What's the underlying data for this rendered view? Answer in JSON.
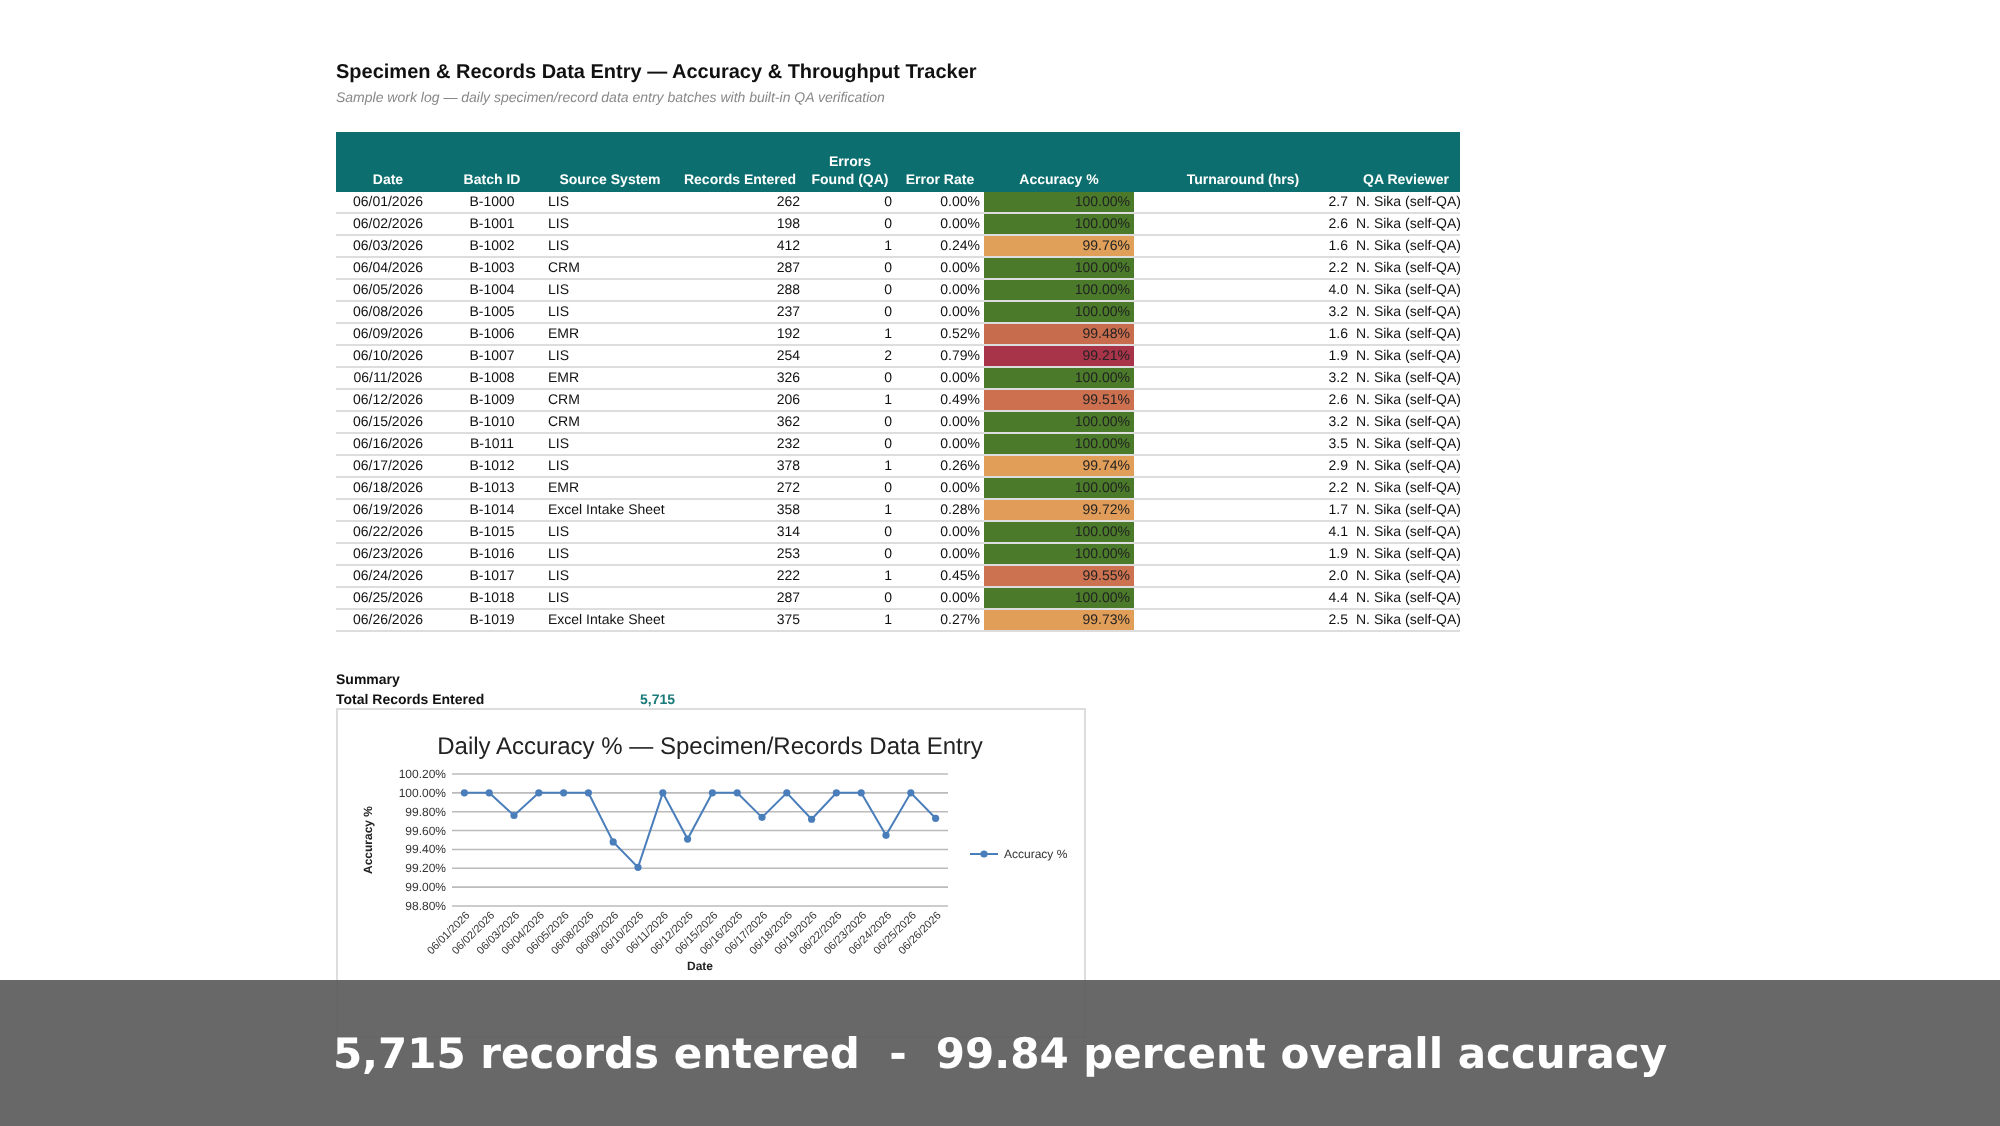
{
  "title": "Specimen & Records Data Entry — Accuracy & Throughput Tracker",
  "subtitle": "Sample work log — daily specimen/record data entry batches with built-in QA verification",
  "table": {
    "columns": [
      "Date",
      "Batch ID",
      "Source System",
      "Records Entered",
      "Errors Found (QA)",
      "Error Rate",
      "Accuracy %",
      "Turnaround (hrs)",
      "QA Reviewer"
    ],
    "rows": [
      {
        "date": "06/01/2026",
        "batch": "B-1000",
        "source": "LIS",
        "records": "262",
        "errors": "0",
        "rate": "0.00%",
        "accuracy": "100.00%",
        "color": "#4a7a2a",
        "hours": "2.7",
        "reviewer": "N. Sika (self-QA)"
      },
      {
        "date": "06/02/2026",
        "batch": "B-1001",
        "source": "LIS",
        "records": "198",
        "errors": "0",
        "rate": "0.00%",
        "accuracy": "100.00%",
        "color": "#4a7a2a",
        "hours": "2.6",
        "reviewer": "N. Sika (self-QA)"
      },
      {
        "date": "06/03/2026",
        "batch": "B-1002",
        "source": "LIS",
        "records": "412",
        "errors": "1",
        "rate": "0.24%",
        "accuracy": "99.76%",
        "color": "#e0a05a",
        "hours": "1.6",
        "reviewer": "N. Sika (self-QA)"
      },
      {
        "date": "06/04/2026",
        "batch": "B-1003",
        "source": "CRM",
        "records": "287",
        "errors": "0",
        "rate": "0.00%",
        "accuracy": "100.00%",
        "color": "#4a7a2a",
        "hours": "2.2",
        "reviewer": "N. Sika (self-QA)"
      },
      {
        "date": "06/05/2026",
        "batch": "B-1004",
        "source": "LIS",
        "records": "288",
        "errors": "0",
        "rate": "0.00%",
        "accuracy": "100.00%",
        "color": "#4a7a2a",
        "hours": "4.0",
        "reviewer": "N. Sika (self-QA)"
      },
      {
        "date": "06/08/2026",
        "batch": "B-1005",
        "source": "LIS",
        "records": "237",
        "errors": "0",
        "rate": "0.00%",
        "accuracy": "100.00%",
        "color": "#4a7a2a",
        "hours": "3.2",
        "reviewer": "N. Sika (self-QA)"
      },
      {
        "date": "06/09/2026",
        "batch": "B-1006",
        "source": "EMR",
        "records": "192",
        "errors": "1",
        "rate": "0.52%",
        "accuracy": "99.48%",
        "color": "#c86c4e",
        "hours": "1.6",
        "reviewer": "N. Sika (self-QA)"
      },
      {
        "date": "06/10/2026",
        "batch": "B-1007",
        "source": "LIS",
        "records": "254",
        "errors": "2",
        "rate": "0.79%",
        "accuracy": "99.21%",
        "color": "#a8344a",
        "hours": "1.9",
        "reviewer": "N. Sika (self-QA)"
      },
      {
        "date": "06/11/2026",
        "batch": "B-1008",
        "source": "EMR",
        "records": "326",
        "errors": "0",
        "rate": "0.00%",
        "accuracy": "100.00%",
        "color": "#4a7a2a",
        "hours": "3.2",
        "reviewer": "N. Sika (self-QA)"
      },
      {
        "date": "06/12/2026",
        "batch": "B-1009",
        "source": "CRM",
        "records": "206",
        "errors": "1",
        "rate": "0.49%",
        "accuracy": "99.51%",
        "color": "#cc7050",
        "hours": "2.6",
        "reviewer": "N. Sika (self-QA)"
      },
      {
        "date": "06/15/2026",
        "batch": "B-1010",
        "source": "CRM",
        "records": "362",
        "errors": "0",
        "rate": "0.00%",
        "accuracy": "100.00%",
        "color": "#4a7a2a",
        "hours": "3.2",
        "reviewer": "N. Sika (self-QA)"
      },
      {
        "date": "06/16/2026",
        "batch": "B-1011",
        "source": "LIS",
        "records": "232",
        "errors": "0",
        "rate": "0.00%",
        "accuracy": "100.00%",
        "color": "#4a7a2a",
        "hours": "3.5",
        "reviewer": "N. Sika (self-QA)"
      },
      {
        "date": "06/17/2026",
        "batch": "B-1012",
        "source": "LIS",
        "records": "378",
        "errors": "1",
        "rate": "0.26%",
        "accuracy": "99.74%",
        "color": "#e09e58",
        "hours": "2.9",
        "reviewer": "N. Sika (self-QA)"
      },
      {
        "date": "06/18/2026",
        "batch": "B-1013",
        "source": "EMR",
        "records": "272",
        "errors": "0",
        "rate": "0.00%",
        "accuracy": "100.00%",
        "color": "#4a7a2a",
        "hours": "2.2",
        "reviewer": "N. Sika (self-QA)"
      },
      {
        "date": "06/19/2026",
        "batch": "B-1014",
        "source": "Excel Intake Sheet",
        "records": "358",
        "errors": "1",
        "rate": "0.28%",
        "accuracy": "99.72%",
        "color": "#e09c58",
        "hours": "1.7",
        "reviewer": "N. Sika (self-QA)"
      },
      {
        "date": "06/22/2026",
        "batch": "B-1015",
        "source": "LIS",
        "records": "314",
        "errors": "0",
        "rate": "0.00%",
        "accuracy": "100.00%",
        "color": "#4a7a2a",
        "hours": "4.1",
        "reviewer": "N. Sika (self-QA)"
      },
      {
        "date": "06/23/2026",
        "batch": "B-1016",
        "source": "LIS",
        "records": "253",
        "errors": "0",
        "rate": "0.00%",
        "accuracy": "100.00%",
        "color": "#4a7a2a",
        "hours": "1.9",
        "reviewer": "N. Sika (self-QA)"
      },
      {
        "date": "06/24/2026",
        "batch": "B-1017",
        "source": "LIS",
        "records": "222",
        "errors": "1",
        "rate": "0.45%",
        "accuracy": "99.55%",
        "color": "#cc7250",
        "hours": "2.0",
        "reviewer": "N. Sika (self-QA)"
      },
      {
        "date": "06/25/2026",
        "batch": "B-1018",
        "source": "LIS",
        "records": "287",
        "errors": "0",
        "rate": "0.00%",
        "accuracy": "100.00%",
        "color": "#4a7a2a",
        "hours": "4.4",
        "reviewer": "N. Sika (self-QA)"
      },
      {
        "date": "06/26/2026",
        "batch": "B-1019",
        "source": "Excel Intake Sheet",
        "records": "375",
        "errors": "1",
        "rate": "0.27%",
        "accuracy": "99.73%",
        "color": "#e09e58",
        "hours": "2.5",
        "reviewer": "N. Sika (self-QA)"
      }
    ]
  },
  "summary": {
    "heading": "Summary",
    "label": "Total Records Entered",
    "value": "5,715"
  },
  "chart": {
    "chart_data": {
      "type": "line",
      "title": "Daily Accuracy % — Specimen/Records Data Entry",
      "xlabel": "Date",
      "ylabel": "Accuracy %",
      "categories": [
        "06/01/2026",
        "06/02/2026",
        "06/03/2026",
        "06/04/2026",
        "06/05/2026",
        "06/08/2026",
        "06/09/2026",
        "06/10/2026",
        "06/11/2026",
        "06/12/2026",
        "06/15/2026",
        "06/16/2026",
        "06/17/2026",
        "06/18/2026",
        "06/19/2026",
        "06/22/2026",
        "06/23/2026",
        "06/24/2026",
        "06/25/2026",
        "06/26/2026"
      ],
      "series": [
        {
          "name": "Accuracy %",
          "color": "#4a7ebb",
          "values": [
            100,
            100,
            99.76,
            100,
            100,
            100,
            99.48,
            99.21,
            100,
            99.51,
            100,
            100,
            99.74,
            100,
            99.72,
            100,
            100,
            99.55,
            100,
            99.73
          ]
        }
      ],
      "ylim": [
        98.8,
        100.2
      ],
      "grid": true,
      "marker": "circle",
      "yticks": [
        {
          "value": 98.8,
          "label": "98.80%"
        },
        {
          "value": 99.0,
          "label": "99.00%"
        },
        {
          "value": 99.2,
          "label": "99.20%"
        },
        {
          "value": 99.4,
          "label": "99.40%"
        },
        {
          "value": 99.6,
          "label": "99.60%"
        },
        {
          "value": 99.8,
          "label": "99.80%"
        },
        {
          "value": 100.0,
          "label": "100.00%"
        },
        {
          "value": 100.2,
          "label": "100.20%"
        }
      ]
    }
  },
  "caption": "5,715 records entered  -  99.84 percent overall accuracy"
}
